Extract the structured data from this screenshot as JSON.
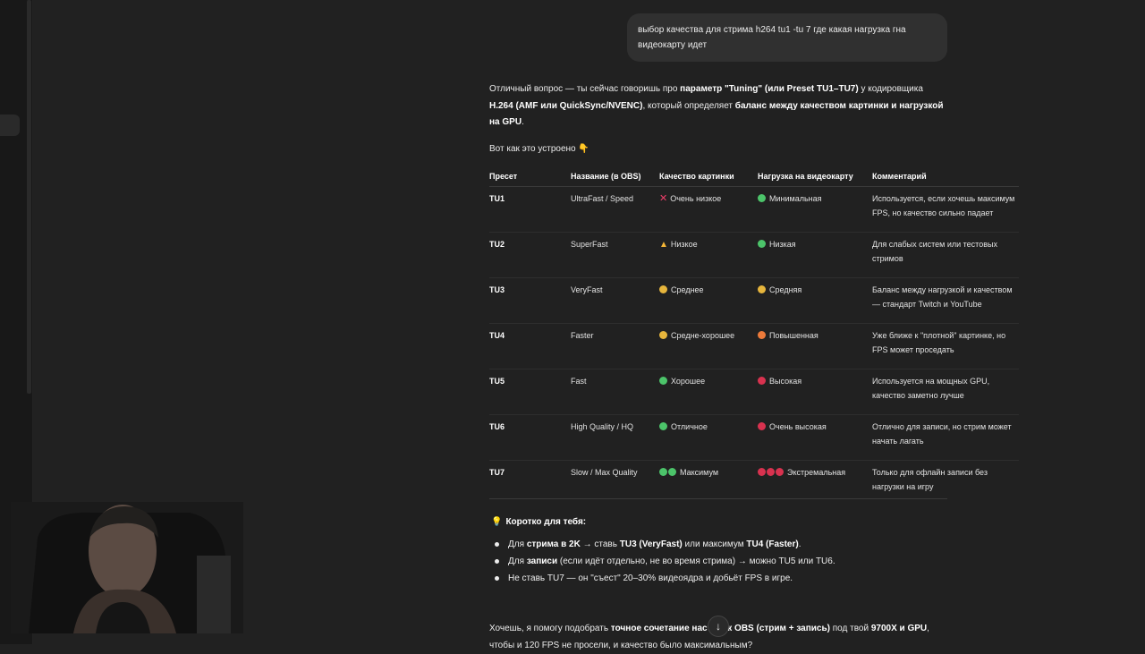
{
  "user_message": "выбор качества для стрима h264 tu1 -tu 7 где какая нагрузка гна видеокарту идет",
  "intro": {
    "p1": "Отличный вопрос — ты сейчас говоришь про ",
    "b1": "параметр \"Tuning\" (или Preset TU1–TU7)",
    "p2": " у кодировщика ",
    "b2": "H.264 (AMF или QuickSync/NVENC)",
    "p3": ", который определяет ",
    "b3": "баланс между качеством картинки и нагрузкой на GPU",
    "p4": "."
  },
  "lead": "Вот как это устроено 👇",
  "table": {
    "headers": [
      "Пресет",
      "Название (в OBS)",
      "Качество картинки",
      "Нагрузка на видеокарту",
      "Комментарий"
    ],
    "rows": [
      {
        "preset": "TU1",
        "name": "UltraFast / Speed",
        "quality": "Очень низкое",
        "load": "Минимальная",
        "comment": "Используется, если хочешь максимум FPS, но качество сильно падает"
      },
      {
        "preset": "TU2",
        "name": "SuperFast",
        "quality": "Низкое",
        "load": "Низкая",
        "comment": "Для слабых систем или тестовых стримов"
      },
      {
        "preset": "TU3",
        "name": "VeryFast",
        "quality": "Среднее",
        "load": "Средняя",
        "comment": "Баланс между нагрузкой и качеством — стандарт Twitch и YouTube"
      },
      {
        "preset": "TU4",
        "name": "Faster",
        "quality": "Средне-хорошее",
        "load": "Повышенная",
        "comment": "Уже ближе к \"плотной\" картинке, но FPS может проседать"
      },
      {
        "preset": "TU5",
        "name": "Fast",
        "quality": "Хорошее",
        "load": "Высокая",
        "comment": "Используется на мощных GPU, качество заметно лучше"
      },
      {
        "preset": "TU6",
        "name": "High Quality / HQ",
        "quality": "Отличное",
        "load": "Очень высокая",
        "comment": "Отлично для записи, но стрим может начать лагать"
      },
      {
        "preset": "TU7",
        "name": "Slow / Max Quality",
        "quality": "Максимум",
        "load": "Экстремальная",
        "comment": "Только для офлайн записи без нагрузки на игру"
      }
    ]
  },
  "summary": {
    "heading": "Коротко для тебя:",
    "b1": {
      "t1": "Для ",
      "b1": "стрима в 2K",
      "t2": " → ставь ",
      "b2": "TU3 (VeryFast)",
      "t3": " или максимум ",
      "b3": "TU4 (Faster)",
      "t4": "."
    },
    "b2": {
      "t1": "Для ",
      "b1": "записи",
      "t2": " (если идёт отдельно, не во время стрима) → можно TU5 или TU6."
    },
    "b3": {
      "t1": "Не ставь TU7 — он \"съест\" 20–30% видеоядра и добьёт FPS в игре."
    }
  },
  "final": {
    "t1": "Хочешь, я помогу подобрать ",
    "b1": "точное сочетание настроек OBS (стрим + запись)",
    "t2": " под твой ",
    "b2": "9700X и GPU",
    "t3": ",",
    "t4": "чтобы и 120 FPS не просели, и качество было максимальным?"
  },
  "colors": {
    "background": "#212121",
    "user_bubble": "#303030",
    "dot_green": "#4cc46a",
    "dot_yellow": "#e6b53c",
    "dot_orange": "#ec7a3a",
    "dot_red": "#d8324f",
    "cross_red": "#f03e6a"
  },
  "icons": {
    "scroll_down": "arrow-down-icon",
    "tip": "lightbulb-icon"
  }
}
